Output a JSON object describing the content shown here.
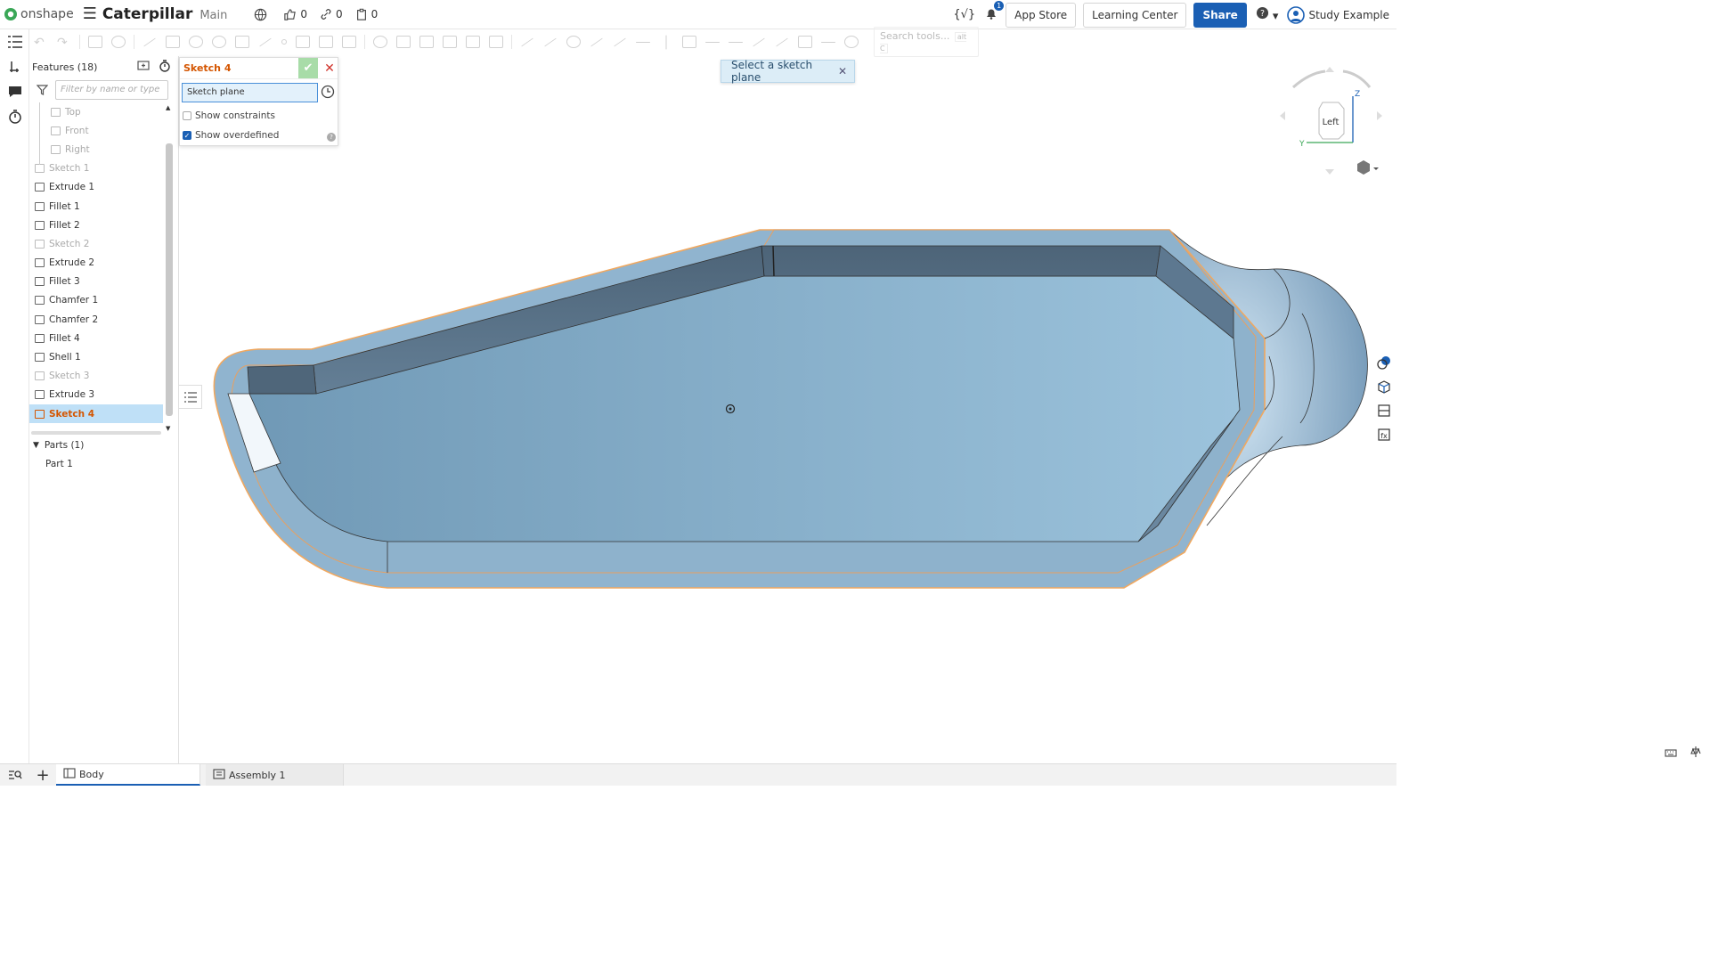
{
  "header": {
    "brand": "onshape",
    "doc_title": "Caterpillar",
    "workspace": "Main",
    "likes": "0",
    "links": "0",
    "copies": "0",
    "notification_count": "1",
    "app_store": "App Store",
    "learning_center": "Learning Center",
    "share": "Share",
    "user": "Study Example"
  },
  "toolbar": {
    "search_placeholder": "Search tools...",
    "search_shortcut": "alt C"
  },
  "features": {
    "title": "Features (18)",
    "filter_placeholder": "Filter by name or type",
    "items": [
      {
        "label": "Top",
        "kind": "plane"
      },
      {
        "label": "Front",
        "kind": "plane"
      },
      {
        "label": "Right",
        "kind": "plane"
      },
      {
        "label": "Sketch 1",
        "kind": "sketch-dim"
      },
      {
        "label": "Extrude 1",
        "kind": "normal"
      },
      {
        "label": "Fillet 1",
        "kind": "normal"
      },
      {
        "label": "Fillet 2",
        "kind": "normal"
      },
      {
        "label": "Sketch 2",
        "kind": "sketch-dim"
      },
      {
        "label": "Extrude 2",
        "kind": "normal"
      },
      {
        "label": "Fillet 3",
        "kind": "normal"
      },
      {
        "label": "Chamfer 1",
        "kind": "normal"
      },
      {
        "label": "Chamfer 2",
        "kind": "normal"
      },
      {
        "label": "Fillet 4",
        "kind": "normal"
      },
      {
        "label": "Shell 1",
        "kind": "normal"
      },
      {
        "label": "Sketch 3",
        "kind": "sketch-dim"
      },
      {
        "label": "Extrude 3",
        "kind": "normal"
      },
      {
        "label": "Sketch 4",
        "kind": "selected"
      }
    ],
    "parts_title": "Parts (1)",
    "parts": [
      "Part 1"
    ]
  },
  "sketch_dialog": {
    "title": "Sketch 4",
    "plane_field": "Sketch plane",
    "show_constraints": "Show constraints",
    "show_overdefined": "Show overdefined",
    "show_constraints_checked": false,
    "show_overdefined_checked": true
  },
  "toast": {
    "message": "Select a sketch plane"
  },
  "view_cube": {
    "face": "Left",
    "axis_z": "Z",
    "axis_y": "Y"
  },
  "tabs": {
    "body": "Body",
    "assembly": "Assembly 1"
  },
  "colors": {
    "accent": "#1a5fb4",
    "selected_feature": "#d45500",
    "model_fill": "#8fb3cd",
    "model_edge": "#f0a860"
  }
}
